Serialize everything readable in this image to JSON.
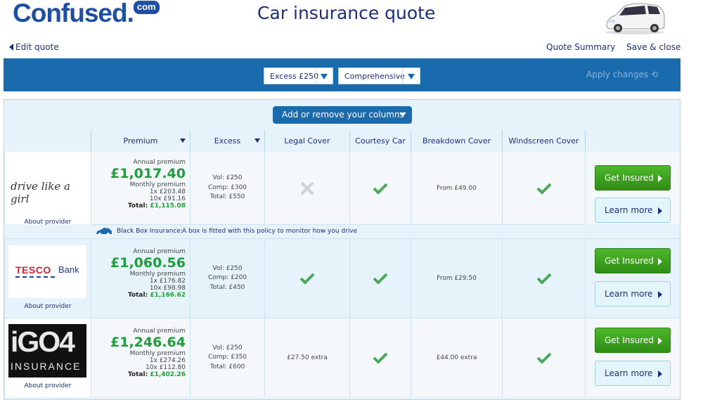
{
  "header": {
    "logo_main": "Confused.",
    "logo_badge": "com",
    "title": "Car insurance quote",
    "edit_quote": "Edit quote",
    "quote_summary": "Quote Summary",
    "save_close": "Save & close"
  },
  "filters": {
    "excess": "Excess £250",
    "cover": "Comprehensive",
    "apply": "Apply changes"
  },
  "add_columns": "Add or remove your columns",
  "columns": [
    "Premium",
    "Excess",
    "Legal Cover",
    "Courtesy Car",
    "Breakdown Cover",
    "Windscreen Cover"
  ],
  "labels": {
    "annual": "Annual premium",
    "monthly": "Monthly premium",
    "total": "Total:",
    "get_insured": "Get Insured",
    "learn_more": "Learn more",
    "about": "About provider"
  },
  "black_box": {
    "title": "Black Box Insurance:",
    "text": "A box is fitted with this policy to monitor how you drive"
  },
  "quotes": [
    {
      "provider": "drive like a girl",
      "annual": "£1,017.40",
      "m1": "1x £203.48",
      "m10": "10x £91.16",
      "total": "£1,115.08",
      "vol": "Vol: £250",
      "comp": "Comp: £300",
      "tot_excess": "Total: £550",
      "legal": "cross",
      "courtesy": "check",
      "breakdown": "From £49.00",
      "windscreen": "check"
    },
    {
      "provider_a": "TESCO",
      "provider_b": "Bank",
      "annual": "£1,060.56",
      "m1": "1x £176.82",
      "m10": "10x £98.98",
      "total": "£1,166.62",
      "vol": "Vol: £250",
      "comp": "Comp: £200",
      "tot_excess": "Total: £450",
      "legal": "check",
      "courtesy": "check",
      "breakdown": "From £29.50",
      "windscreen": "check"
    },
    {
      "provider_a": "iGO4",
      "provider_b": "INSURANCE",
      "annual": "£1,246.64",
      "m1": "1x £274.26",
      "m10": "10x £112.80",
      "total": "£1,402.26",
      "vol": "Vol: £250",
      "comp": "Comp: £350",
      "tot_excess": "Total: £600",
      "legal": "£27.50 extra",
      "courtesy": "check",
      "breakdown": "£44.00 extra",
      "windscreen": "check"
    }
  ],
  "colors": {
    "brand": "#1f4fa3",
    "bar": "#1a6aae",
    "price": "#1e9e3b",
    "check": "#4aa85a"
  }
}
